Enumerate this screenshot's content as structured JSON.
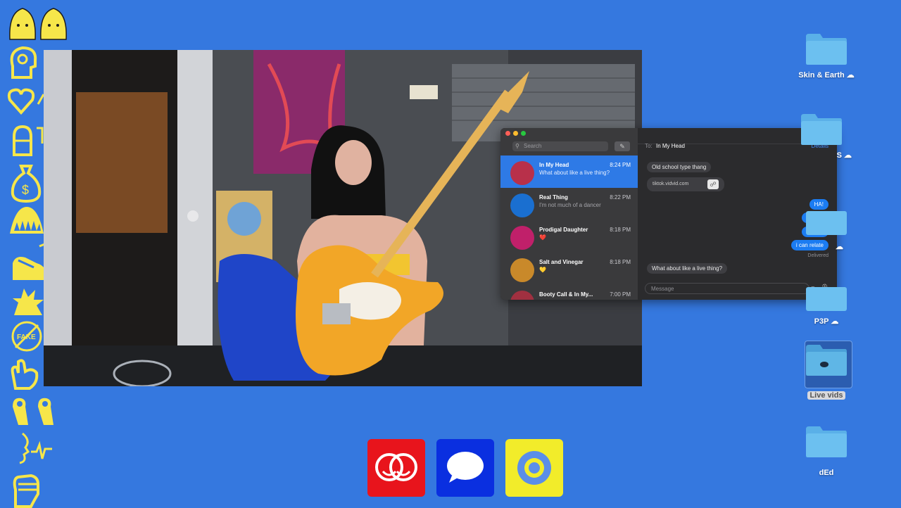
{
  "colors": {
    "desktop": "#3578df",
    "sticker": "#f6e64a",
    "accent": "#1b7cf2"
  },
  "stickers": [
    "twin-heads-icon",
    "brain-head-icon",
    "heart-icon",
    "salt-shaker-icon",
    "money-bag-icon",
    "teeth-icon",
    "sneaker-icon",
    "explosion-icon",
    "no-fake-icon",
    "snap-hand-icon",
    "ok-hands-icon",
    "face-pulse-icon",
    "fist-icon"
  ],
  "video": {
    "description_icon": "live-video-frame"
  },
  "messages": {
    "search_placeholder": "Search",
    "conversations": [
      {
        "name": "In My Head",
        "time": "8:24 PM",
        "preview": "What about like a live thing?",
        "selected": true,
        "color": "#b8304a"
      },
      {
        "name": "Real Thing",
        "time": "8:22 PM",
        "preview": "I'm not much of a dancer",
        "selected": false,
        "color": "#1a6fd0"
      },
      {
        "name": "Prodigal Daughter",
        "time": "8:18 PM",
        "preview": "❤️",
        "selected": false,
        "color": "#c0206a"
      },
      {
        "name": "Salt and Vinegar",
        "time": "8:18 PM",
        "preview": "💛",
        "selected": false,
        "color": "#c9892a"
      },
      {
        "name": "Booty Call & In My...",
        "time": "7:00 PM",
        "preview": "",
        "selected": false,
        "color": "#a03040"
      }
    ],
    "chat": {
      "to_label": "To:",
      "to_name": "In My Head",
      "details_label": "Details",
      "bubbles_in_top": "Old school type thang",
      "link_text": "tiktok.vidvid.com",
      "outgoing": [
        "HA!",
        "i mean",
        "maybe",
        "i can relate"
      ],
      "delivered": "Delivered",
      "last_in": "What about like a live thing?",
      "input_placeholder": "Message"
    }
  },
  "folders": [
    {
      "label": "Skin & Earth",
      "cloud": true
    },
    {
      "label": "S",
      "cloud": true
    },
    {
      "label": "",
      "cloud": true
    },
    {
      "label": "P3P",
      "cloud": true
    },
    {
      "label": "Live vids",
      "selected": true
    },
    {
      "label": "dEd"
    }
  ],
  "dock": [
    {
      "name": "smiley-app",
      "color": "#e8141c"
    },
    {
      "name": "messages-app",
      "color": "#0a2fe0"
    },
    {
      "name": "swirl-app",
      "color": "#f2ec2a"
    }
  ]
}
